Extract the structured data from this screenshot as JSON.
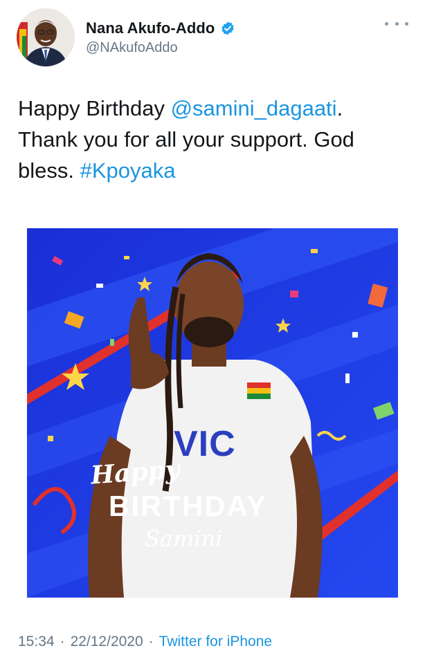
{
  "user": {
    "display_name": "Nana Akufo-Addo",
    "handle": "@NAkufoAddo",
    "verified": true,
    "avatar_icon": "profile-photo"
  },
  "tweet": {
    "text_part1": "Happy Birthday ",
    "mention": "@samini_dagaati",
    "text_part2": ". Thank you for all your support. God bless. ",
    "hashtag": "#Kpoyaka"
  },
  "media": {
    "shirt_text": "VIC",
    "happy": "Happy",
    "birthday": "BIRTHDAY",
    "name": "Samini",
    "background_color": "#1f3ae0"
  },
  "footer": {
    "time": "15:34",
    "separator1": "·",
    "date": "22/12/2020",
    "separator2": "·",
    "source": "Twitter for iPhone"
  },
  "colors": {
    "link": "#1b95e0",
    "secondary_text": "#657786",
    "verified_badge": "#1da1f2"
  }
}
